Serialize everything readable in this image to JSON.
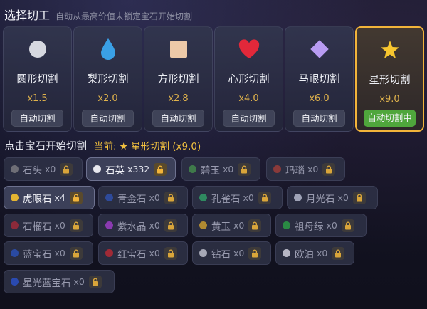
{
  "header": {
    "title": "选择切工",
    "subtitle": "自动从最高价值未锁定宝石开始切割"
  },
  "colors": {
    "accent": "#f2b43a",
    "active_button": "#4fa63c",
    "multiplier": "#e0b34c"
  },
  "cuts": [
    {
      "name": "圆形切割",
      "mult": "x1.5",
      "button": "自动切割",
      "icon": "circle-icon",
      "active": false
    },
    {
      "name": "梨形切割",
      "mult": "x2.0",
      "button": "自动切割",
      "icon": "drop-icon",
      "active": false
    },
    {
      "name": "方形切割",
      "mult": "x2.8",
      "button": "自动切割",
      "icon": "square-icon",
      "active": false
    },
    {
      "name": "心形切割",
      "mult": "x4.0",
      "button": "自动切割",
      "icon": "heart-icon",
      "active": false
    },
    {
      "name": "马眼切割",
      "mult": "x6.0",
      "button": "自动切割",
      "icon": "diamond-icon",
      "active": false
    },
    {
      "name": "星形切割",
      "mult": "x9.0",
      "button": "自动切割中",
      "icon": "star-icon",
      "active": true
    }
  ],
  "current": {
    "prompt": "点击宝石开始切割",
    "label": "当前:",
    "value": "★ 星形切割 (x9.0)"
  },
  "gems": [
    {
      "name": "石头",
      "count": "x0",
      "color": "#6e6e76"
    },
    {
      "name": "石英",
      "count": "x332",
      "color": "#e8e8ee"
    },
    {
      "name": "碧玉",
      "count": "x0",
      "color": "#3f7a4a"
    },
    {
      "name": "玛瑙",
      "count": "x0",
      "color": "#8a3a3a"
    },
    {
      "name": "虎眼石",
      "count": "x4",
      "color": "#e5b532"
    },
    {
      "name": "青金石",
      "count": "x0",
      "color": "#2e4a9a"
    },
    {
      "name": "孔雀石",
      "count": "x0",
      "color": "#2f8a60"
    },
    {
      "name": "月光石",
      "count": "x0",
      "color": "#9ea2b6"
    },
    {
      "name": "石榴石",
      "count": "x0",
      "color": "#8c2a3a"
    },
    {
      "name": "紫水晶",
      "count": "x0",
      "color": "#8a3ab0"
    },
    {
      "name": "黄玉",
      "count": "x0",
      "color": "#b08a32"
    },
    {
      "name": "祖母绿",
      "count": "x0",
      "color": "#2a8a44"
    },
    {
      "name": "蓝宝石",
      "count": "x0",
      "color": "#2a4aa2"
    },
    {
      "name": "红宝石",
      "count": "x0",
      "color": "#a02a36"
    },
    {
      "name": "钻石",
      "count": "x0",
      "color": "#a6a8b6"
    },
    {
      "name": "欧泊",
      "count": "x0",
      "color": "#b6b6c4"
    },
    {
      "name": "星光蓝宝石",
      "count": "x0",
      "color": "#2a4ab0"
    }
  ]
}
